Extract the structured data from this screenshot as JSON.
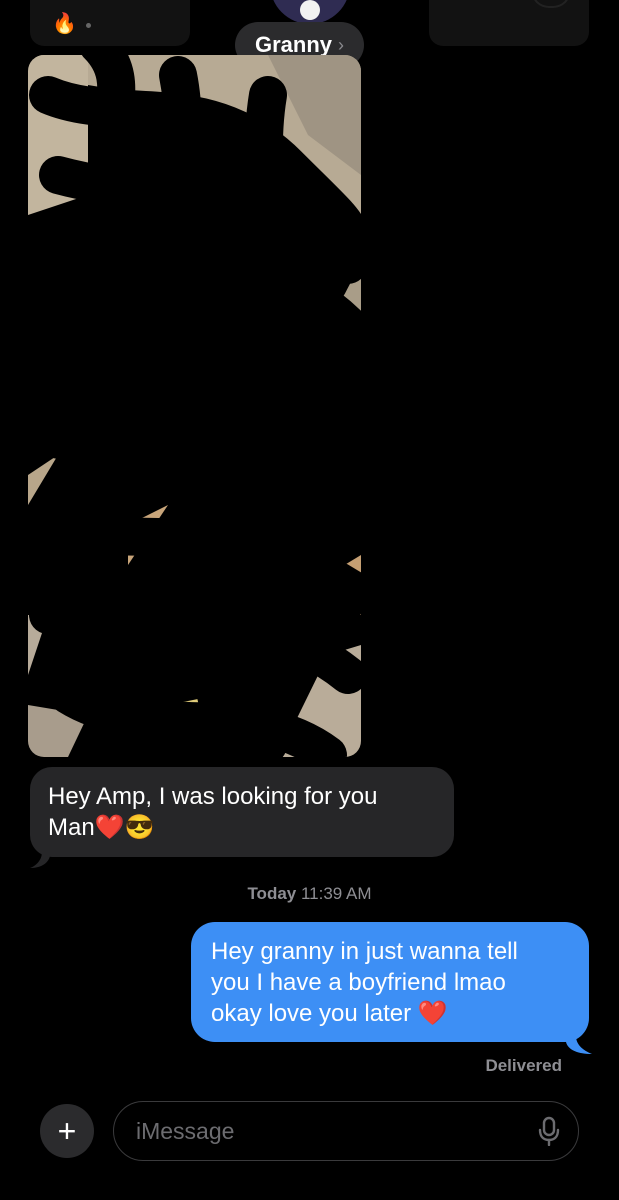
{
  "header": {
    "contact_name": "Granny",
    "chevron": "›",
    "left_icon": "🔥"
  },
  "messages": {
    "incoming": {
      "line1": "Hey Amp, I was looking for you",
      "line2": "Man❤️😎"
    },
    "timestamp_day": "Today",
    "timestamp_time": "11:39 AM",
    "outgoing": {
      "line1": "Hey granny in just wanna tell",
      "line2": "you I have a boyfriend lmao",
      "line3": "okay love you later ❤️"
    },
    "status": "Delivered"
  },
  "composer": {
    "plus": "+",
    "placeholder": "iMessage"
  },
  "colors": {
    "outgoing_bubble": "#3d8ff5",
    "incoming_bubble": "#262628",
    "background": "#000000"
  }
}
